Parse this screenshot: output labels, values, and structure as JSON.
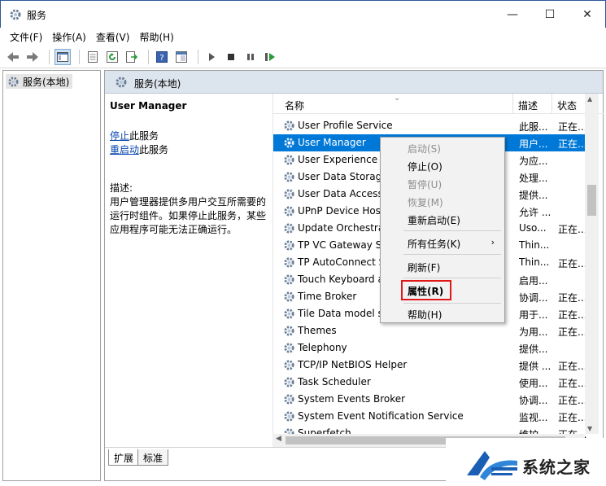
{
  "window": {
    "title": "服务",
    "minimize": "—",
    "maximize": "☐",
    "close": "✕"
  },
  "menu": [
    {
      "label": "文件(F)"
    },
    {
      "label": "操作(A)"
    },
    {
      "label": "查看(V)"
    },
    {
      "label": "帮助(H)"
    }
  ],
  "tree": {
    "root_label": "服务(本地)"
  },
  "panel": {
    "header_title": "服务(本地)",
    "selected_service": "User Manager",
    "stop_link": "停止",
    "stop_suffix": "此服务",
    "restart_link": "重启动",
    "restart_suffix": "此服务",
    "description_label": "描述:",
    "description_text": "用户管理器提供多用户交互所需要的运行时组件。如果停止此服务，某些应用程序可能无法正确运行。"
  },
  "columns": {
    "name": "名称",
    "description": "描述",
    "status": "状态"
  },
  "services": [
    {
      "name": "User Profile Service",
      "desc": "此服...",
      "status": "正在..."
    },
    {
      "name": "User Manager",
      "desc": "用户...",
      "status": "正在...",
      "selected": true
    },
    {
      "name": "User Experience V",
      "desc": "为应...",
      "status": ""
    },
    {
      "name": "User Data Storag",
      "desc": "处理...",
      "status": ""
    },
    {
      "name": "User Data Access",
      "desc": "提供...",
      "status": ""
    },
    {
      "name": "UPnP Device Host",
      "desc": "允许 ...",
      "status": ""
    },
    {
      "name": "Update Orchestra",
      "desc": "Uso...",
      "status": "正在..."
    },
    {
      "name": "TP VC Gateway Se",
      "desc": "Thin...",
      "status": ""
    },
    {
      "name": "TP AutoConnect S",
      "desc": "Thin...",
      "status": "正在..."
    },
    {
      "name": "Touch Keyboard a",
      "desc": "启用...",
      "status": ""
    },
    {
      "name": "Time Broker",
      "desc": "协调...",
      "status": "正在..."
    },
    {
      "name": "Tile Data model s",
      "desc": "用于...",
      "status": "正在..."
    },
    {
      "name": "Themes",
      "desc": "为用...",
      "status": "正在..."
    },
    {
      "name": "Telephony",
      "desc": "提供...",
      "status": ""
    },
    {
      "name": "TCP/IP NetBIOS Helper",
      "desc": "提供 ...",
      "status": "正在..."
    },
    {
      "name": "Task Scheduler",
      "desc": "使用...",
      "status": "正在..."
    },
    {
      "name": "System Events Broker",
      "desc": "协调...",
      "status": "正在..."
    },
    {
      "name": "System Event Notification Service",
      "desc": "监视...",
      "status": "正在..."
    },
    {
      "name": "Superfetch",
      "desc": "维护...",
      "status": "正在..."
    }
  ],
  "context_menu": {
    "start": "启动(S)",
    "stop": "停止(O)",
    "pause": "暂停(U)",
    "resume": "恢复(M)",
    "restart": "重新启动(E)",
    "all_tasks": "所有任务(K)",
    "refresh": "刷新(F)",
    "properties": "属性(R)",
    "help": "帮助(H)",
    "highlight_color": "#e01818"
  },
  "tabs": [
    {
      "label": "扩展"
    },
    {
      "label": "标准"
    }
  ],
  "watermark": {
    "text": "系统之家"
  },
  "colors": {
    "selection": "#0078d7",
    "header_bg": "#dce4ee",
    "link": "#0645ad"
  }
}
